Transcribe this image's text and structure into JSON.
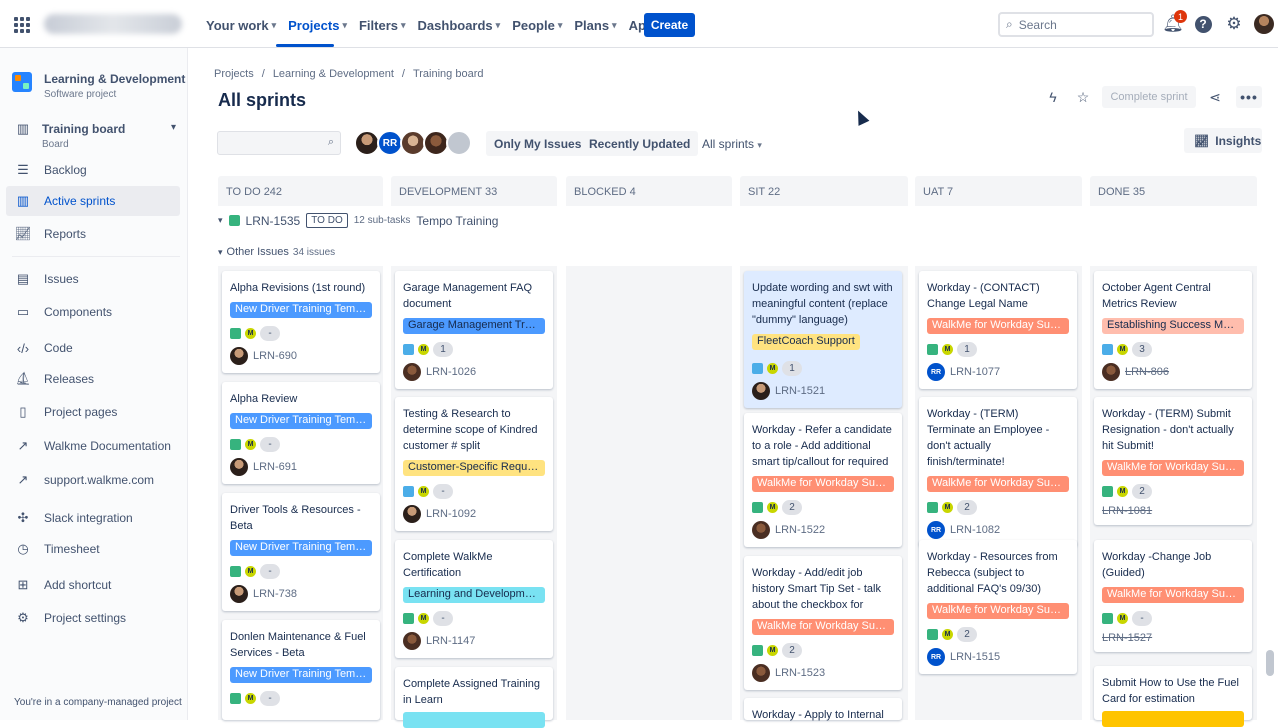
{
  "topnav": {
    "items": [
      {
        "label": "Your work"
      },
      {
        "label": "Projects"
      },
      {
        "label": "Filters"
      },
      {
        "label": "Dashboards"
      },
      {
        "label": "People"
      },
      {
        "label": "Plans"
      },
      {
        "label": "Apps"
      }
    ],
    "create_label": "Create",
    "search_placeholder": "Search",
    "notification_count": "1"
  },
  "sidebar": {
    "project_name": "Learning & Development",
    "project_type": "Software project",
    "board_name": "Training board",
    "board_sub": "Board",
    "items": [
      {
        "label": "Backlog",
        "icon": "backlog-icon"
      },
      {
        "label": "Active sprints",
        "icon": "board-icon"
      },
      {
        "label": "Reports",
        "icon": "reports-icon"
      },
      {
        "label": "Issues",
        "icon": "issues-icon"
      },
      {
        "label": "Components",
        "icon": "components-icon"
      },
      {
        "label": "Code",
        "icon": "code-icon"
      },
      {
        "label": "Releases",
        "icon": "releases-icon"
      },
      {
        "label": "Project pages",
        "icon": "pages-icon"
      },
      {
        "label": "Walkme Documentation",
        "icon": "external-link-icon"
      },
      {
        "label": "support.walkme.com",
        "icon": "external-link-icon"
      },
      {
        "label": "Slack integration",
        "icon": "slack-icon"
      },
      {
        "label": "Timesheet",
        "icon": "timesheet-icon"
      },
      {
        "label": "Add shortcut",
        "icon": "add-shortcut-icon"
      },
      {
        "label": "Project settings",
        "icon": "gear-icon"
      }
    ],
    "footer": "You're in a company-managed project"
  },
  "breadcrumb": [
    "Projects",
    "Learning & Development",
    "Training board"
  ],
  "page_title": "All sprints",
  "actions": {
    "complete_sprint": "Complete sprint",
    "insights": "Insights"
  },
  "filters": {
    "only_my_issues": "Only My Issues",
    "recently_updated": "Recently Updated",
    "all_sprints": "All sprints",
    "assignee_rr": "RR"
  },
  "columns": [
    {
      "name": "TO DO 242"
    },
    {
      "name": "DEVELOPMENT 33"
    },
    {
      "name": "BLOCKED 4"
    },
    {
      "name": "SIT 22"
    },
    {
      "name": "UAT 7"
    },
    {
      "name": "DONE 35"
    }
  ],
  "swimlanes": {
    "lane1": {
      "key": "LRN-1535",
      "status": "TO DO",
      "subtasks": "12 sub-tasks",
      "title": "Tempo Training"
    },
    "lane2": {
      "title": "Other Issues",
      "count": "34 issues"
    }
  },
  "colors": {
    "epic_blue": "#4c9aff",
    "epic_yellow": "#ffe380",
    "epic_teal": "#79e2f2",
    "epic_red": "#ff8f73",
    "epic_salmon": "#ffbdad",
    "accent": "#0052cc"
  },
  "cards": {
    "todo": [
      {
        "title": "Alpha Revisions (1st round)",
        "epic": "New Driver Training Temp...",
        "est": "-",
        "key": "LRN-690"
      },
      {
        "title": "Alpha Review",
        "epic": "New Driver Training Temp...",
        "est": "-",
        "key": "LRN-691"
      },
      {
        "title": "Driver Tools & Resources - Beta",
        "epic": "New Driver Training Temp...",
        "est": "-",
        "key": "LRN-738"
      },
      {
        "title": "Donlen Maintenance & Fuel Services - Beta",
        "epic": "New Driver Training Temp...",
        "est": "-",
        "key": ""
      }
    ],
    "dev": [
      {
        "title": "Garage Management FAQ document",
        "epic": "Garage Management Trai...",
        "est": "1",
        "key": "LRN-1026"
      },
      {
        "title": "Testing & Research to determine scope of Kindred customer # split",
        "epic": "Customer-Specific Requests",
        "est": "-",
        "key": "LRN-1092"
      },
      {
        "title": "Complete WalkMe Certification",
        "epic": "Learning and Developme...",
        "est": "-",
        "key": "LRN-1147"
      },
      {
        "title": "Complete Assigned Training in Learn",
        "epic": "",
        "est": "",
        "key": ""
      }
    ],
    "sit": [
      {
        "title": "Update wording and swt with meaningful content (replace \"dummy\" language)",
        "epic": "FleetCoach Support",
        "est": "1",
        "key": "LRN-1521"
      },
      {
        "title": "Workday - Refer a candidate to a role - Add additional smart tip/callout for required",
        "epic": "WalkMe for Workday Sup...",
        "est": "2",
        "key": "LRN-1522"
      },
      {
        "title": "Workday - Add/edit job history Smart Tip Set - talk about the checkbox for",
        "epic": "WalkMe for Workday Sup...",
        "est": "2",
        "key": "LRN-1523"
      },
      {
        "title": "Workday - Apply to Internal",
        "epic": "",
        "est": "",
        "key": ""
      }
    ],
    "uat": [
      {
        "title": "Workday - (CONTACT) Change Legal Name",
        "epic": "WalkMe for Workday Sup...",
        "est": "1",
        "key": "LRN-1077"
      },
      {
        "title": "Workday - (TERM) Terminate an Employee - don't actually finish/terminate!",
        "epic": "WalkMe for Workday Sup...",
        "est": "2",
        "key": "LRN-1082"
      },
      {
        "title": "Workday - Resources from Rebecca (subject to additional FAQ's 09/30)",
        "epic": "WalkMe for Workday Sup...",
        "est": "2",
        "key": "LRN-1515"
      }
    ],
    "done": [
      {
        "title": "October Agent Central Metrics Review",
        "epic": "Establishing Success Metri...",
        "est": "3",
        "key": "LRN-806"
      },
      {
        "title": "Workday - (TERM) Submit Resignation - don't actually hit Submit!",
        "epic": "WalkMe for Workday Sup...",
        "est": "2",
        "key": "LRN-1081"
      },
      {
        "title": "Workday -Change Job (Guided)",
        "epic": "WalkMe for Workday Sup...",
        "est": "-",
        "key": "LRN-1527"
      },
      {
        "title": "Submit How to Use the Fuel Card for estimation",
        "epic": "",
        "est": "",
        "key": ""
      }
    ]
  }
}
